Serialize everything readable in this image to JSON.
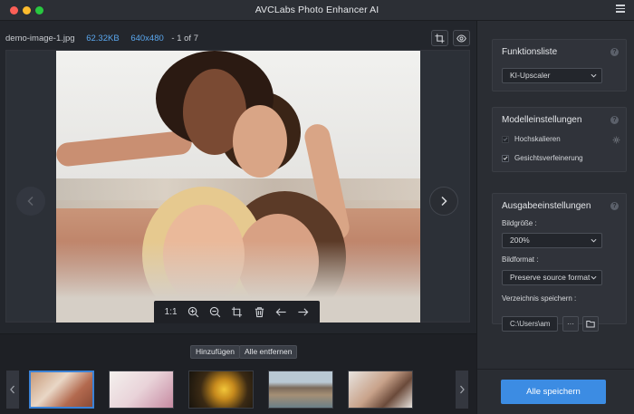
{
  "app": {
    "title": "AVCLabs Photo Enhancer AI"
  },
  "file": {
    "name": "demo-image-1.jpg",
    "size": "62.32KB",
    "dimensions": "640x480",
    "pages": "- 1 of 7"
  },
  "viewer": {
    "zoom_label": "1:1"
  },
  "strip": {
    "add_label": "Hinzufügen",
    "remove_all_label": "Alle entfernen"
  },
  "panel": {
    "function_list": {
      "title": "Funktionsliste",
      "help": "?",
      "selected": "KI-Upscaler"
    },
    "model_settings": {
      "title": "Modelleinstellungen",
      "help": "?",
      "upscale_label": "Hochskalieren",
      "upscale_checked": true,
      "face_label": "Gesichtsverfeinerung",
      "face_checked": true
    },
    "output_settings": {
      "title": "Ausgabeeinstellungen",
      "help": "?",
      "size_label": "Bildgröße :",
      "size_value": "200%",
      "format_label": "Bildformat :",
      "format_value": "Preserve source format",
      "dir_label": "Verzeichnis speichern :",
      "dir_value": "C:\\Users\\am",
      "dots_label": "···"
    },
    "save_all_label": "Alle speichern"
  },
  "colors": {
    "accent": "#3c8ce3",
    "file_meta": "#5aa7ee",
    "active_thumb_border": "#3b82d6"
  }
}
